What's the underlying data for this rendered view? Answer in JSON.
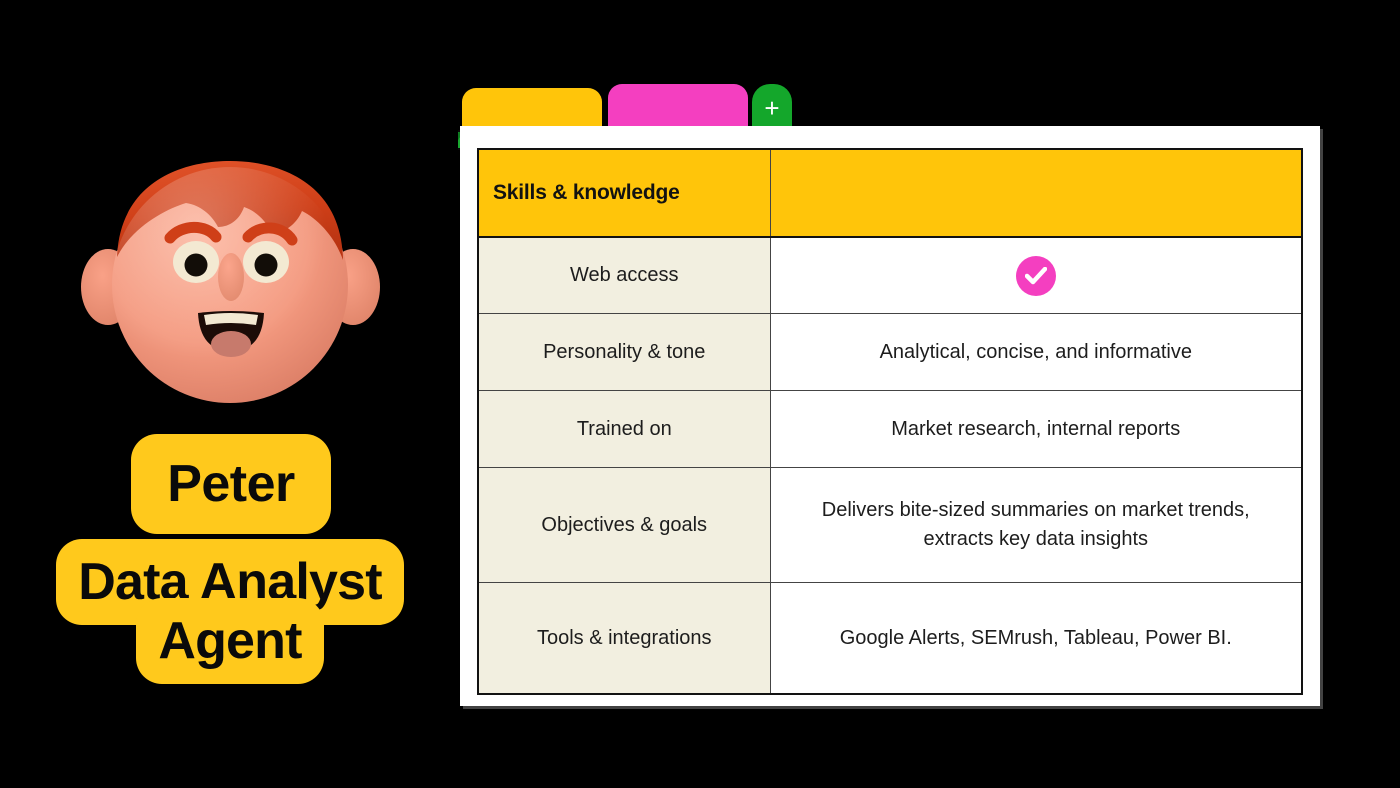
{
  "theme": {
    "background": "#000000",
    "yellow": "#FFC91C",
    "tab_yellow": "#FFC50A",
    "pink": "#F43FC0",
    "green": "#1AA830",
    "beige": "#F2EFE0",
    "card_white": "#FFFFFF",
    "text_dark": "#121212"
  },
  "persona": {
    "name": "Peter",
    "role": "Data Analyst Agent",
    "avatar_alt": "3D cartoon avatar of a smiling person with red hair"
  },
  "browser": {
    "tabs": [
      {
        "id": "tab-1",
        "label": "",
        "color": "#FFC50A",
        "active": false
      },
      {
        "id": "tab-2",
        "label": "",
        "color": "#F43FC0",
        "active": true
      }
    ],
    "new_tab_label": "+"
  },
  "table": {
    "header": {
      "label_column": "Skills & knowledge",
      "value_column": ""
    },
    "rows": [
      {
        "label": "Web access",
        "value": "",
        "value_type": "check",
        "check_label": "Enabled"
      },
      {
        "label": "Personality & tone",
        "value": "Analytical, concise, and informative",
        "value_type": "text"
      },
      {
        "label": "Trained on",
        "value": "Market research, internal reports",
        "value_type": "text"
      },
      {
        "label": "Objectives & goals",
        "value": "Delivers bite-sized summaries on market trends, extracts key data insights",
        "value_type": "text"
      },
      {
        "label": "Tools & integrations",
        "value": "Google Alerts, SEMrush, Tableau, Power BI.",
        "value_type": "text"
      }
    ]
  }
}
